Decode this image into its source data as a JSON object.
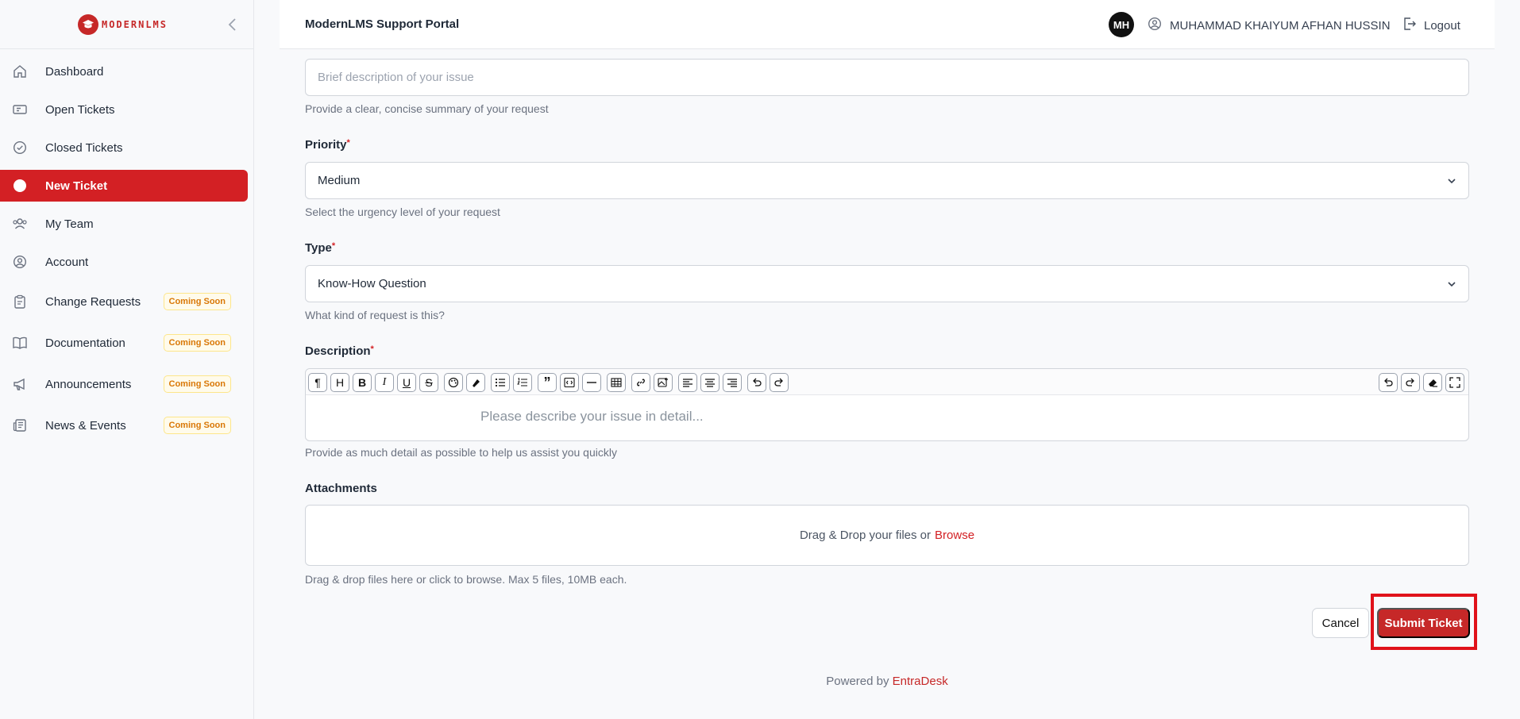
{
  "brand": {
    "logo_text": "MODERNLMS",
    "accent": "#d32024"
  },
  "header": {
    "title": "ModernLMS Support Portal",
    "avatar_initials": "MH",
    "user_name": "MUHAMMAD KHAIYUM AFHAN HUSSIN",
    "logout": "Logout"
  },
  "sidebar": {
    "items": [
      {
        "label": "Dashboard",
        "icon": "home-icon"
      },
      {
        "label": "Open Tickets",
        "icon": "ticket-icon"
      },
      {
        "label": "Closed Tickets",
        "icon": "check-circle-icon"
      },
      {
        "label": "New Ticket",
        "icon": "dot-icon",
        "active": true
      },
      {
        "label": "My Team",
        "icon": "users-icon"
      },
      {
        "label": "Account",
        "icon": "user-circle-icon"
      },
      {
        "label": "Change Requests",
        "icon": "clipboard-icon",
        "badge": "Coming Soon"
      },
      {
        "label": "Documentation",
        "icon": "book-icon",
        "badge": "Coming Soon"
      },
      {
        "label": "Announcements",
        "icon": "megaphone-icon",
        "badge": "Coming Soon"
      },
      {
        "label": "News & Events",
        "icon": "newspaper-icon",
        "badge": "Coming Soon"
      }
    ]
  },
  "form": {
    "subject": {
      "placeholder": "Brief description of your issue",
      "help": "Provide a clear, concise summary of your request"
    },
    "priority": {
      "label": "Priority",
      "required_mark": "*",
      "value": "Medium",
      "help": "Select the urgency level of your request"
    },
    "type": {
      "label": "Type",
      "required_mark": "*",
      "value": "Know-How Question",
      "help": "What kind of request is this?"
    },
    "description": {
      "label": "Description",
      "required_mark": "*",
      "placeholder": "Please describe your issue in detail...",
      "help": "Provide as much detail as possible to help us assist you quickly",
      "toolbar": [
        "paragraph",
        "heading",
        "bold",
        "italic",
        "underline",
        "strikethrough",
        "text-color",
        "highlight",
        "bullet-list",
        "ordered-list",
        "blockquote",
        "code-block",
        "horizontal-rule",
        "table",
        "link",
        "image",
        "align-left",
        "align-center",
        "align-right",
        "undo",
        "redo"
      ],
      "toolbar_right": [
        "undo",
        "redo",
        "clear-format",
        "fullscreen"
      ]
    },
    "attachments": {
      "label": "Attachments",
      "drop_text": "Drag & Drop your files or",
      "browse": "Browse",
      "help": "Drag & drop files here or click to browse. Max 5 files, 10MB each."
    },
    "cancel": "Cancel",
    "submit": "Submit Ticket"
  },
  "footer": {
    "prefix": "Powered by",
    "brand": "EntraDesk"
  }
}
